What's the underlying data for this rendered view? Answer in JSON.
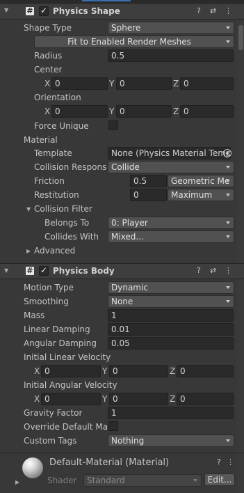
{
  "physics_shape": {
    "title": "Physics Shape",
    "shape_type": {
      "label": "Shape Type",
      "value": "Sphere"
    },
    "fit_button": "Fit to Enabled Render Meshes",
    "radius": {
      "label": "Radius",
      "value": "0.5"
    },
    "center": {
      "label": "Center",
      "x": "0",
      "y": "0",
      "z": "0"
    },
    "orientation": {
      "label": "Orientation",
      "x": "0",
      "y": "0",
      "z": "0"
    },
    "force_unique": {
      "label": "Force Unique"
    },
    "material": {
      "label": "Material",
      "template": {
        "label": "Template",
        "value": "None (Physics Material Temp"
      },
      "collision_response": {
        "label": "Collision Response",
        "value": "Collide"
      },
      "friction": {
        "label": "Friction",
        "value": "0.5",
        "mode": "Geometric Me"
      },
      "restitution": {
        "label": "Restitution",
        "value": "0",
        "mode": "Maximum"
      }
    },
    "collision_filter": {
      "label": "Collision Filter",
      "belongs_to": {
        "label": "Belongs To",
        "value": "0: Player"
      },
      "collides_with": {
        "label": "Collides With",
        "value": "Mixed..."
      }
    },
    "advanced": {
      "label": "Advanced"
    }
  },
  "physics_body": {
    "title": "Physics Body",
    "motion_type": {
      "label": "Motion Type",
      "value": "Dynamic"
    },
    "smoothing": {
      "label": "Smoothing",
      "value": "None"
    },
    "mass": {
      "label": "Mass",
      "value": "1"
    },
    "linear_damping": {
      "label": "Linear Damping",
      "value": "0.01"
    },
    "angular_damping": {
      "label": "Angular Damping",
      "value": "0.05"
    },
    "initial_linear_velocity": {
      "label": "Initial Linear Velocity",
      "x": "0",
      "y": "0",
      "z": "0"
    },
    "initial_angular_velocity": {
      "label": "Initial Angular Velocity",
      "x": "0",
      "y": "0",
      "z": "0"
    },
    "gravity_factor": {
      "label": "Gravity Factor",
      "value": "1"
    },
    "override_default_mass": {
      "label": "Override Default Mas"
    },
    "custom_tags": {
      "label": "Custom Tags",
      "value": "Nothing"
    }
  },
  "material_asset": {
    "title": "Default-Material (Material)",
    "shader_label": "Shader",
    "shader_value": "Standard",
    "edit_button": "Edit..."
  },
  "axes": {
    "x": "X",
    "y": "Y",
    "z": "Z"
  },
  "icons": {
    "check": "✓",
    "help": "?",
    "settings": "⇄",
    "menu": "⋮",
    "hash": "#",
    "collapse": "▼",
    "expand": "▶"
  }
}
